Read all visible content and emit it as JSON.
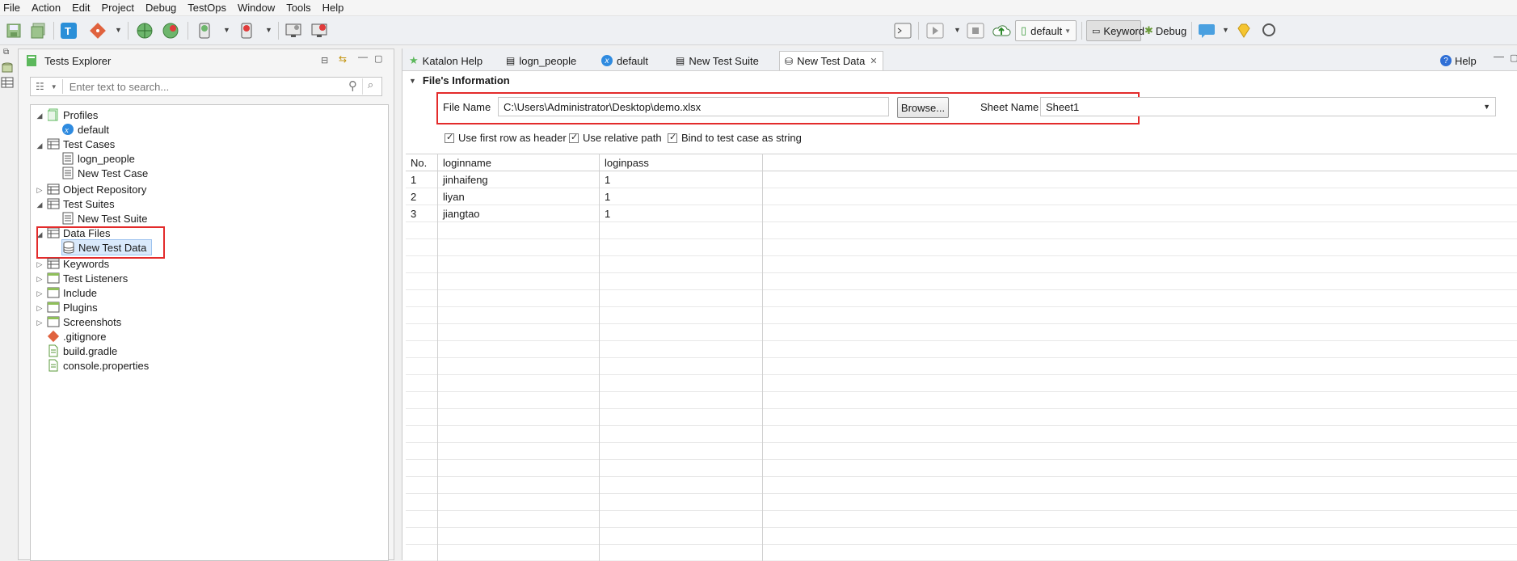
{
  "menu": [
    "File",
    "Action",
    "Edit",
    "Project",
    "Debug",
    "TestOps",
    "Window",
    "Tools",
    "Help"
  ],
  "toolbar": {
    "profile_combo": "default",
    "keyword_label": "Keyword",
    "debug_label": "Debug"
  },
  "explorer": {
    "title": "Tests Explorer",
    "search_placeholder": "Enter text to search...",
    "tree": [
      {
        "label": "Profiles",
        "icon": "profiles-icon",
        "expanded": true
      },
      {
        "label": "default",
        "icon": "profile-x-icon"
      },
      {
        "label": "Test Cases",
        "icon": "folder-icon",
        "expanded": true
      },
      {
        "label": "logn_people",
        "icon": "test-case-icon"
      },
      {
        "label": "New Test Case",
        "icon": "test-case-icon"
      },
      {
        "label": "Object Repository",
        "icon": "folder-icon",
        "expanded": false
      },
      {
        "label": "Test Suites",
        "icon": "folder-icon",
        "expanded": true
      },
      {
        "label": "New Test Suite",
        "icon": "test-suite-icon"
      },
      {
        "label": "Data Files",
        "icon": "folder-icon",
        "expanded": true
      },
      {
        "label": "New Test Data",
        "icon": "test-data-icon",
        "selected": true
      },
      {
        "label": "Keywords",
        "icon": "folder-icon",
        "expanded": false
      },
      {
        "label": "Test Listeners",
        "icon": "folder-icon",
        "expanded": false
      },
      {
        "label": "Include",
        "icon": "folder-icon",
        "expanded": false
      },
      {
        "label": "Plugins",
        "icon": "folder-icon",
        "expanded": false
      },
      {
        "label": "Screenshots",
        "icon": "folder-icon",
        "expanded": false
      },
      {
        "label": ".gitignore",
        "icon": "git-icon"
      },
      {
        "label": "build.gradle",
        "icon": "file-icon"
      },
      {
        "label": "console.properties",
        "icon": "file-icon"
      }
    ]
  },
  "tabs": [
    {
      "label": "Katalon Help"
    },
    {
      "label": "logn_people"
    },
    {
      "label": "default"
    },
    {
      "label": "New Test Suite"
    },
    {
      "label": "New Test Data",
      "active": true
    }
  ],
  "help_label": "Help",
  "file_info": {
    "section_title": "File's Information",
    "file_name_label": "File Name",
    "file_name_value": "C:\\Users\\Administrator\\Desktop\\demo.xlsx",
    "browse_label": "Browse...",
    "sheet_name_label": "Sheet Name",
    "sheet_name_value": "Sheet1",
    "options": [
      "Use first row as header",
      "Use relative path",
      "Bind to test case as string"
    ]
  },
  "table": {
    "headers": [
      "No.",
      "loginname",
      "loginpass"
    ],
    "rows": [
      [
        "1",
        "jinhaifeng",
        "1"
      ],
      [
        "2",
        "liyan",
        "1"
      ],
      [
        "3",
        "jiangtao",
        "1"
      ]
    ]
  },
  "colors": {
    "highlight": "#e32b2b",
    "accent": "#2f6fd6"
  }
}
